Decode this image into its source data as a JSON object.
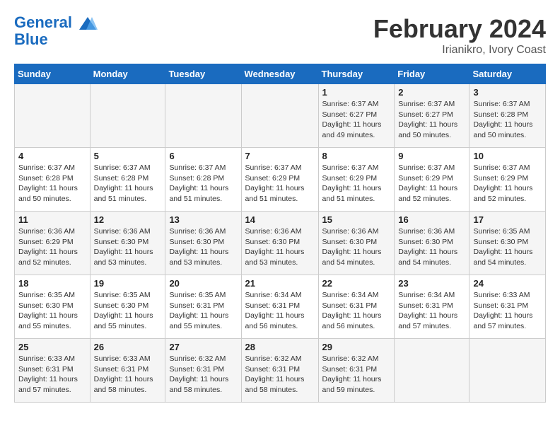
{
  "header": {
    "logo_line1": "General",
    "logo_line2": "Blue",
    "month_title": "February 2024",
    "location": "Irianikro, Ivory Coast"
  },
  "days_of_week": [
    "Sunday",
    "Monday",
    "Tuesday",
    "Wednesday",
    "Thursday",
    "Friday",
    "Saturday"
  ],
  "weeks": [
    [
      {
        "day": "",
        "info": ""
      },
      {
        "day": "",
        "info": ""
      },
      {
        "day": "",
        "info": ""
      },
      {
        "day": "",
        "info": ""
      },
      {
        "day": "1",
        "info": "Sunrise: 6:37 AM\nSunset: 6:27 PM\nDaylight: 11 hours and 49 minutes."
      },
      {
        "day": "2",
        "info": "Sunrise: 6:37 AM\nSunset: 6:27 PM\nDaylight: 11 hours and 50 minutes."
      },
      {
        "day": "3",
        "info": "Sunrise: 6:37 AM\nSunset: 6:28 PM\nDaylight: 11 hours and 50 minutes."
      }
    ],
    [
      {
        "day": "4",
        "info": "Sunrise: 6:37 AM\nSunset: 6:28 PM\nDaylight: 11 hours and 50 minutes."
      },
      {
        "day": "5",
        "info": "Sunrise: 6:37 AM\nSunset: 6:28 PM\nDaylight: 11 hours and 51 minutes."
      },
      {
        "day": "6",
        "info": "Sunrise: 6:37 AM\nSunset: 6:28 PM\nDaylight: 11 hours and 51 minutes."
      },
      {
        "day": "7",
        "info": "Sunrise: 6:37 AM\nSunset: 6:29 PM\nDaylight: 11 hours and 51 minutes."
      },
      {
        "day": "8",
        "info": "Sunrise: 6:37 AM\nSunset: 6:29 PM\nDaylight: 11 hours and 51 minutes."
      },
      {
        "day": "9",
        "info": "Sunrise: 6:37 AM\nSunset: 6:29 PM\nDaylight: 11 hours and 52 minutes."
      },
      {
        "day": "10",
        "info": "Sunrise: 6:37 AM\nSunset: 6:29 PM\nDaylight: 11 hours and 52 minutes."
      }
    ],
    [
      {
        "day": "11",
        "info": "Sunrise: 6:36 AM\nSunset: 6:29 PM\nDaylight: 11 hours and 52 minutes."
      },
      {
        "day": "12",
        "info": "Sunrise: 6:36 AM\nSunset: 6:30 PM\nDaylight: 11 hours and 53 minutes."
      },
      {
        "day": "13",
        "info": "Sunrise: 6:36 AM\nSunset: 6:30 PM\nDaylight: 11 hours and 53 minutes."
      },
      {
        "day": "14",
        "info": "Sunrise: 6:36 AM\nSunset: 6:30 PM\nDaylight: 11 hours and 53 minutes."
      },
      {
        "day": "15",
        "info": "Sunrise: 6:36 AM\nSunset: 6:30 PM\nDaylight: 11 hours and 54 minutes."
      },
      {
        "day": "16",
        "info": "Sunrise: 6:36 AM\nSunset: 6:30 PM\nDaylight: 11 hours and 54 minutes."
      },
      {
        "day": "17",
        "info": "Sunrise: 6:35 AM\nSunset: 6:30 PM\nDaylight: 11 hours and 54 minutes."
      }
    ],
    [
      {
        "day": "18",
        "info": "Sunrise: 6:35 AM\nSunset: 6:30 PM\nDaylight: 11 hours and 55 minutes."
      },
      {
        "day": "19",
        "info": "Sunrise: 6:35 AM\nSunset: 6:30 PM\nDaylight: 11 hours and 55 minutes."
      },
      {
        "day": "20",
        "info": "Sunrise: 6:35 AM\nSunset: 6:31 PM\nDaylight: 11 hours and 55 minutes."
      },
      {
        "day": "21",
        "info": "Sunrise: 6:34 AM\nSunset: 6:31 PM\nDaylight: 11 hours and 56 minutes."
      },
      {
        "day": "22",
        "info": "Sunrise: 6:34 AM\nSunset: 6:31 PM\nDaylight: 11 hours and 56 minutes."
      },
      {
        "day": "23",
        "info": "Sunrise: 6:34 AM\nSunset: 6:31 PM\nDaylight: 11 hours and 57 minutes."
      },
      {
        "day": "24",
        "info": "Sunrise: 6:33 AM\nSunset: 6:31 PM\nDaylight: 11 hours and 57 minutes."
      }
    ],
    [
      {
        "day": "25",
        "info": "Sunrise: 6:33 AM\nSunset: 6:31 PM\nDaylight: 11 hours and 57 minutes."
      },
      {
        "day": "26",
        "info": "Sunrise: 6:33 AM\nSunset: 6:31 PM\nDaylight: 11 hours and 58 minutes."
      },
      {
        "day": "27",
        "info": "Sunrise: 6:32 AM\nSunset: 6:31 PM\nDaylight: 11 hours and 58 minutes."
      },
      {
        "day": "28",
        "info": "Sunrise: 6:32 AM\nSunset: 6:31 PM\nDaylight: 11 hours and 58 minutes."
      },
      {
        "day": "29",
        "info": "Sunrise: 6:32 AM\nSunset: 6:31 PM\nDaylight: 11 hours and 59 minutes."
      },
      {
        "day": "",
        "info": ""
      },
      {
        "day": "",
        "info": ""
      }
    ]
  ]
}
